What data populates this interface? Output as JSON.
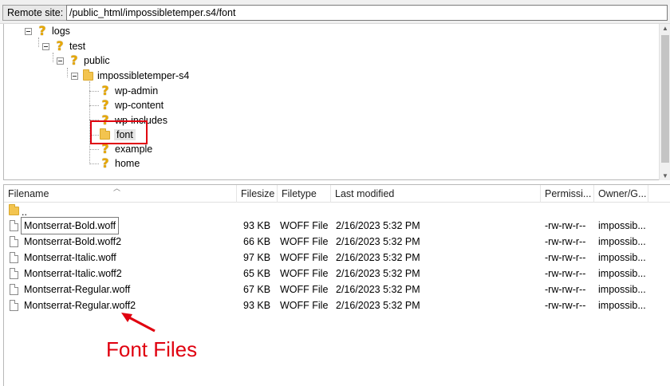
{
  "site_bar": {
    "label": "Remote site:",
    "path": "/public_html/impossibletemper.s4/font"
  },
  "tree": {
    "nodes": [
      {
        "label": "logs",
        "icon": "question-folder-icon"
      },
      {
        "label": "test",
        "icon": "question-folder-icon"
      },
      {
        "label": "public",
        "icon": "question-folder-icon"
      },
      {
        "label": "impossibletemper-s4",
        "icon": "folder-icon"
      },
      {
        "label": "wp-admin",
        "icon": "question-folder-icon"
      },
      {
        "label": "wp-content",
        "icon": "question-folder-icon"
      },
      {
        "label": "wp-includes",
        "icon": "question-folder-icon"
      },
      {
        "label": "font",
        "icon": "folder-icon"
      },
      {
        "label": "example",
        "icon": "question-folder-icon"
      },
      {
        "label": "home",
        "icon": "question-folder-icon"
      }
    ]
  },
  "list": {
    "columns": {
      "filename": "Filename",
      "filesize": "Filesize",
      "filetype": "Filetype",
      "last_modified": "Last modified",
      "permissions": "Permissi...",
      "owner": "Owner/G..."
    },
    "parent": "..",
    "rows": [
      {
        "name": "Montserrat-Bold.woff",
        "size": "93 KB",
        "type": "WOFF File",
        "modified": "2/16/2023 5:32 PM",
        "perm": "-rw-rw-r--",
        "owner": "impossib..."
      },
      {
        "name": "Montserrat-Bold.woff2",
        "size": "66 KB",
        "type": "WOFF File",
        "modified": "2/16/2023 5:32 PM",
        "perm": "-rw-rw-r--",
        "owner": "impossib..."
      },
      {
        "name": "Montserrat-Italic.woff",
        "size": "97 KB",
        "type": "WOFF File",
        "modified": "2/16/2023 5:32 PM",
        "perm": "-rw-rw-r--",
        "owner": "impossib..."
      },
      {
        "name": "Montserrat-Italic.woff2",
        "size": "65 KB",
        "type": "WOFF File",
        "modified": "2/16/2023 5:32 PM",
        "perm": "-rw-rw-r--",
        "owner": "impossib..."
      },
      {
        "name": "Montserrat-Regular.woff",
        "size": "67 KB",
        "type": "WOFF File",
        "modified": "2/16/2023 5:32 PM",
        "perm": "-rw-rw-r--",
        "owner": "impossib..."
      },
      {
        "name": "Montserrat-Regular.woff2",
        "size": "93 KB",
        "type": "WOFF File",
        "modified": "2/16/2023 5:32 PM",
        "perm": "-rw-rw-r--",
        "owner": "impossib..."
      }
    ]
  },
  "annotation": {
    "text": "Font Files",
    "color": "#e0000f"
  }
}
